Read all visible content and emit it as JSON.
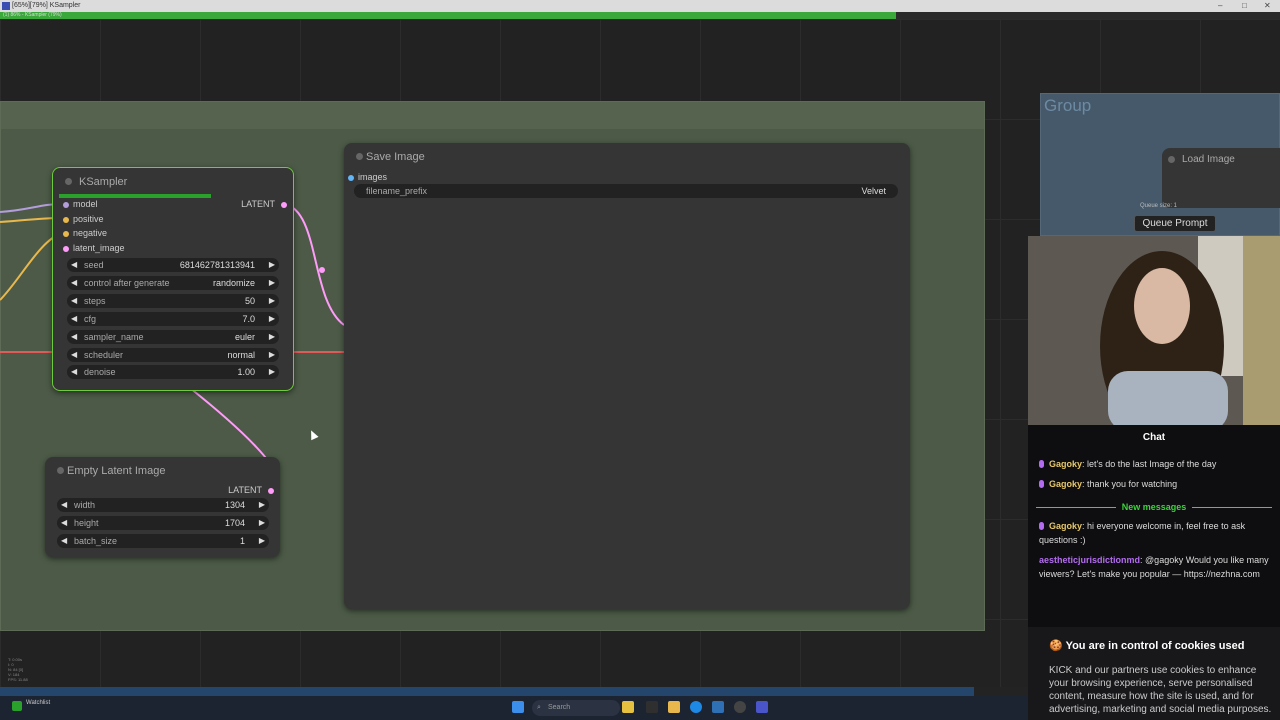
{
  "window": {
    "title": "[65%][79%] KSampler"
  },
  "progress": {
    "label": "(1) 86% - KSampler (79%)",
    "fraction": 0.7
  },
  "ksampler": {
    "title": "KSampler",
    "progress_fraction": 0.66,
    "inputs": [
      {
        "label": "model",
        "color": "#b39ddb"
      },
      {
        "label": "positive",
        "color": "#e8b84d"
      },
      {
        "label": "negative",
        "color": "#e8b84d"
      },
      {
        "label": "latent_image",
        "color": "#ff9cf9"
      }
    ],
    "output": "LATENT",
    "widgets": [
      {
        "label": "seed",
        "value": "681462781313941"
      },
      {
        "label": "control after generate",
        "value": "randomize"
      },
      {
        "label": "steps",
        "value": "50"
      },
      {
        "label": "cfg",
        "value": "7.0"
      },
      {
        "label": "sampler_name",
        "value": "euler"
      },
      {
        "label": "scheduler",
        "value": "normal"
      },
      {
        "label": "denoise",
        "value": "1.00"
      }
    ]
  },
  "save_image": {
    "title": "Save Image",
    "input": "images",
    "widget": {
      "label": "filename_prefix",
      "value": "Velvet"
    }
  },
  "empty_latent": {
    "title": "Empty Latent Image",
    "output": "LATENT",
    "widgets": [
      {
        "label": "width",
        "value": "1304"
      },
      {
        "label": "height",
        "value": "1704"
      },
      {
        "label": "batch_size",
        "value": "1"
      }
    ]
  },
  "group_right": {
    "title": "Group"
  },
  "load_image": {
    "title": "Load Image"
  },
  "queue": {
    "size_label": "Queue size: 1",
    "button": "Queue Prompt"
  },
  "chat": {
    "header": "Chat",
    "new_messages": "New messages",
    "messages": [
      {
        "user": "Gagoky",
        "text": "let's do the last Image of the day"
      },
      {
        "user": "Gagoky",
        "text": "thank you for watching"
      },
      {
        "user": "Gagoky",
        "text": "hi everyone welcome in, feel free to ask questions :)"
      },
      {
        "user": "aestheticjurisdictionmd",
        "text": "@gagoky Would you like many viewers? Let's make you popular — https://nezhna.com"
      }
    ],
    "cookie_title": "You are in control of cookies used",
    "cookie_body": "KICK and our partners use cookies to enhance your browsing experience, serve personalised content, measure how the site is used, and for advertising, marketing and social media purposes."
  },
  "taskbar": {
    "search_placeholder": "Search",
    "weather": "Watchlist"
  },
  "colors": {
    "accent_green": "#6ecb3a",
    "link_pink": "#ff9cf9",
    "link_red": "#e05a5a"
  }
}
